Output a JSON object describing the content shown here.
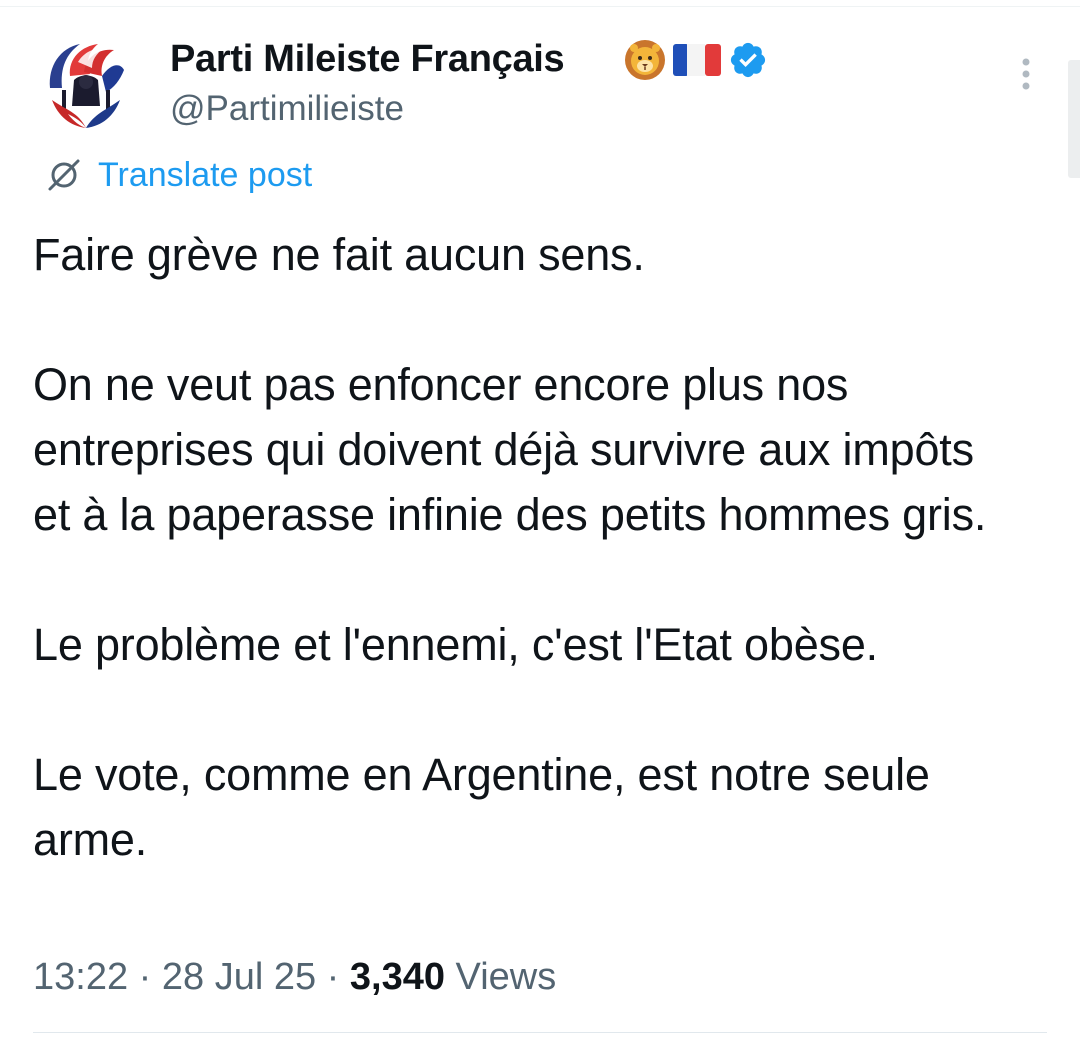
{
  "author": {
    "display_name": "Parti Mileiste Français",
    "handle": "@Partimilieiste",
    "badges": [
      "lion-emoji",
      "france-flag",
      "verified-badge"
    ]
  },
  "translate": {
    "label": "Translate post"
  },
  "post": {
    "paragraphs": [
      "Faire grève ne fait aucun sens.",
      "On ne veut pas enfoncer encore plus nos entreprises qui doivent déjà survivre aux impôts et à la paperasse infinie des petits hommes gris.",
      "Le problème et l'ennemi, c'est l'Etat obèse.",
      "Le vote, comme en Argentine, est notre seule arme."
    ]
  },
  "meta": {
    "time": "13:22",
    "separator": "·",
    "date": "28 Jul 25",
    "views_count": "3,340",
    "views_label": "Views"
  },
  "colors": {
    "link_blue": "#1d9bf0",
    "secondary_text": "#536471",
    "verified_blue": "#1d9bf0"
  }
}
